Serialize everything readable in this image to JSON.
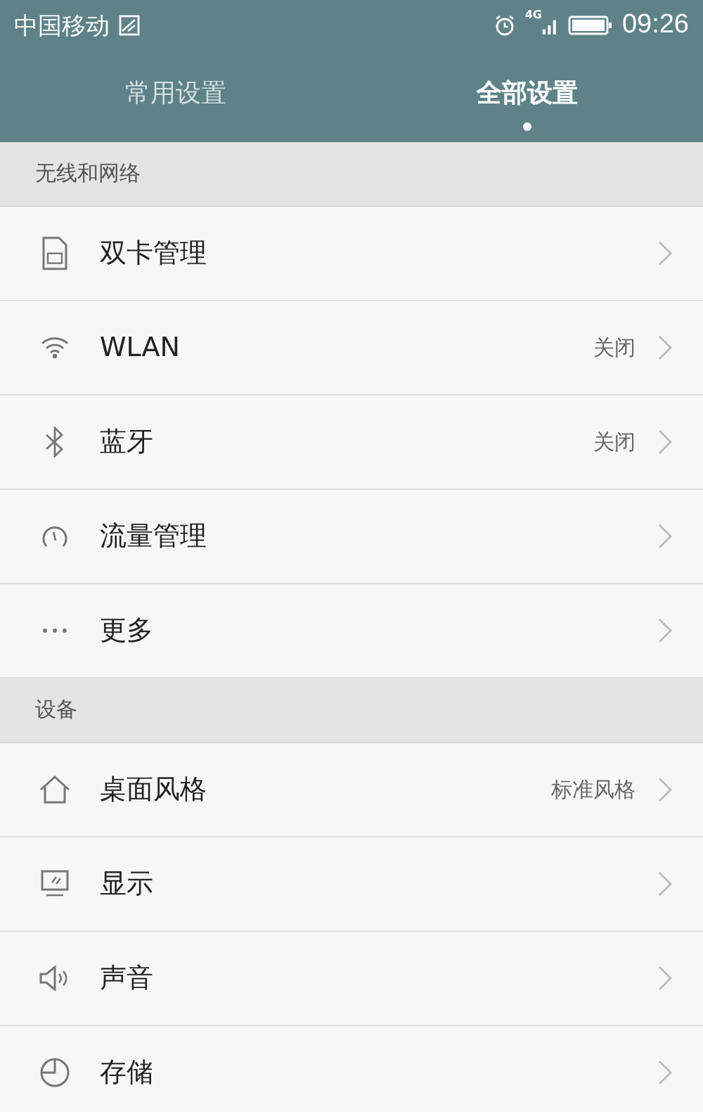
{
  "status_bar": {
    "carrier": "中国移动",
    "network": "4G",
    "time": "09:26"
  },
  "tabs": [
    {
      "label": "常用设置",
      "selected": false
    },
    {
      "label": "全部设置",
      "selected": true
    }
  ],
  "sections": [
    {
      "title": "无线和网络",
      "items": [
        {
          "label": "双卡管理"
        },
        {
          "label": "WLAN",
          "value": "关闭"
        },
        {
          "label": "蓝牙",
          "value": "关闭"
        },
        {
          "label": "流量管理"
        },
        {
          "label": "更多"
        }
      ]
    },
    {
      "title": "设备",
      "items": [
        {
          "label": "桌面风格",
          "value": "标准风格"
        },
        {
          "label": "显示"
        },
        {
          "label": "声音"
        },
        {
          "label": "存储"
        }
      ]
    }
  ]
}
